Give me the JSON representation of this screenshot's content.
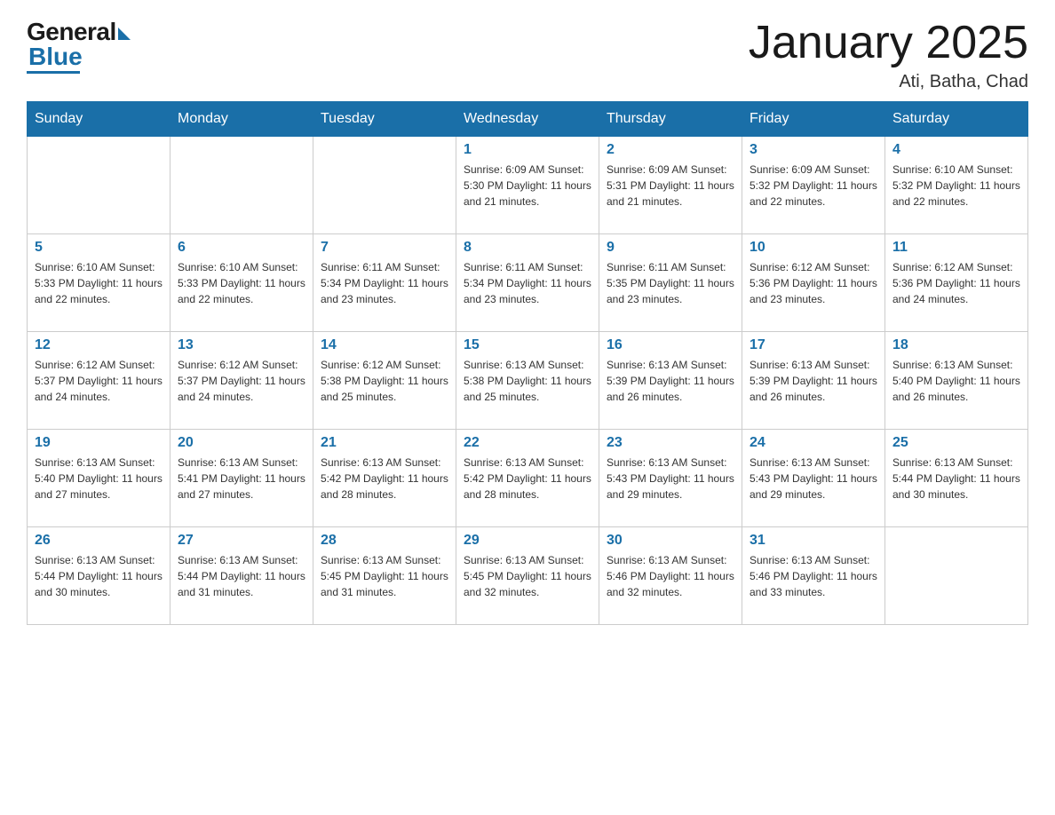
{
  "logo": {
    "general": "General",
    "blue": "Blue"
  },
  "header": {
    "title": "January 2025",
    "location": "Ati, Batha, Chad"
  },
  "days_of_week": [
    "Sunday",
    "Monday",
    "Tuesday",
    "Wednesday",
    "Thursday",
    "Friday",
    "Saturday"
  ],
  "weeks": [
    [
      {
        "day": "",
        "info": ""
      },
      {
        "day": "",
        "info": ""
      },
      {
        "day": "",
        "info": ""
      },
      {
        "day": "1",
        "info": "Sunrise: 6:09 AM\nSunset: 5:30 PM\nDaylight: 11 hours\nand 21 minutes."
      },
      {
        "day": "2",
        "info": "Sunrise: 6:09 AM\nSunset: 5:31 PM\nDaylight: 11 hours\nand 21 minutes."
      },
      {
        "day": "3",
        "info": "Sunrise: 6:09 AM\nSunset: 5:32 PM\nDaylight: 11 hours\nand 22 minutes."
      },
      {
        "day": "4",
        "info": "Sunrise: 6:10 AM\nSunset: 5:32 PM\nDaylight: 11 hours\nand 22 minutes."
      }
    ],
    [
      {
        "day": "5",
        "info": "Sunrise: 6:10 AM\nSunset: 5:33 PM\nDaylight: 11 hours\nand 22 minutes."
      },
      {
        "day": "6",
        "info": "Sunrise: 6:10 AM\nSunset: 5:33 PM\nDaylight: 11 hours\nand 22 minutes."
      },
      {
        "day": "7",
        "info": "Sunrise: 6:11 AM\nSunset: 5:34 PM\nDaylight: 11 hours\nand 23 minutes."
      },
      {
        "day": "8",
        "info": "Sunrise: 6:11 AM\nSunset: 5:34 PM\nDaylight: 11 hours\nand 23 minutes."
      },
      {
        "day": "9",
        "info": "Sunrise: 6:11 AM\nSunset: 5:35 PM\nDaylight: 11 hours\nand 23 minutes."
      },
      {
        "day": "10",
        "info": "Sunrise: 6:12 AM\nSunset: 5:36 PM\nDaylight: 11 hours\nand 23 minutes."
      },
      {
        "day": "11",
        "info": "Sunrise: 6:12 AM\nSunset: 5:36 PM\nDaylight: 11 hours\nand 24 minutes."
      }
    ],
    [
      {
        "day": "12",
        "info": "Sunrise: 6:12 AM\nSunset: 5:37 PM\nDaylight: 11 hours\nand 24 minutes."
      },
      {
        "day": "13",
        "info": "Sunrise: 6:12 AM\nSunset: 5:37 PM\nDaylight: 11 hours\nand 24 minutes."
      },
      {
        "day": "14",
        "info": "Sunrise: 6:12 AM\nSunset: 5:38 PM\nDaylight: 11 hours\nand 25 minutes."
      },
      {
        "day": "15",
        "info": "Sunrise: 6:13 AM\nSunset: 5:38 PM\nDaylight: 11 hours\nand 25 minutes."
      },
      {
        "day": "16",
        "info": "Sunrise: 6:13 AM\nSunset: 5:39 PM\nDaylight: 11 hours\nand 26 minutes."
      },
      {
        "day": "17",
        "info": "Sunrise: 6:13 AM\nSunset: 5:39 PM\nDaylight: 11 hours\nand 26 minutes."
      },
      {
        "day": "18",
        "info": "Sunrise: 6:13 AM\nSunset: 5:40 PM\nDaylight: 11 hours\nand 26 minutes."
      }
    ],
    [
      {
        "day": "19",
        "info": "Sunrise: 6:13 AM\nSunset: 5:40 PM\nDaylight: 11 hours\nand 27 minutes."
      },
      {
        "day": "20",
        "info": "Sunrise: 6:13 AM\nSunset: 5:41 PM\nDaylight: 11 hours\nand 27 minutes."
      },
      {
        "day": "21",
        "info": "Sunrise: 6:13 AM\nSunset: 5:42 PM\nDaylight: 11 hours\nand 28 minutes."
      },
      {
        "day": "22",
        "info": "Sunrise: 6:13 AM\nSunset: 5:42 PM\nDaylight: 11 hours\nand 28 minutes."
      },
      {
        "day": "23",
        "info": "Sunrise: 6:13 AM\nSunset: 5:43 PM\nDaylight: 11 hours\nand 29 minutes."
      },
      {
        "day": "24",
        "info": "Sunrise: 6:13 AM\nSunset: 5:43 PM\nDaylight: 11 hours\nand 29 minutes."
      },
      {
        "day": "25",
        "info": "Sunrise: 6:13 AM\nSunset: 5:44 PM\nDaylight: 11 hours\nand 30 minutes."
      }
    ],
    [
      {
        "day": "26",
        "info": "Sunrise: 6:13 AM\nSunset: 5:44 PM\nDaylight: 11 hours\nand 30 minutes."
      },
      {
        "day": "27",
        "info": "Sunrise: 6:13 AM\nSunset: 5:44 PM\nDaylight: 11 hours\nand 31 minutes."
      },
      {
        "day": "28",
        "info": "Sunrise: 6:13 AM\nSunset: 5:45 PM\nDaylight: 11 hours\nand 31 minutes."
      },
      {
        "day": "29",
        "info": "Sunrise: 6:13 AM\nSunset: 5:45 PM\nDaylight: 11 hours\nand 32 minutes."
      },
      {
        "day": "30",
        "info": "Sunrise: 6:13 AM\nSunset: 5:46 PM\nDaylight: 11 hours\nand 32 minutes."
      },
      {
        "day": "31",
        "info": "Sunrise: 6:13 AM\nSunset: 5:46 PM\nDaylight: 11 hours\nand 33 minutes."
      },
      {
        "day": "",
        "info": ""
      }
    ]
  ]
}
